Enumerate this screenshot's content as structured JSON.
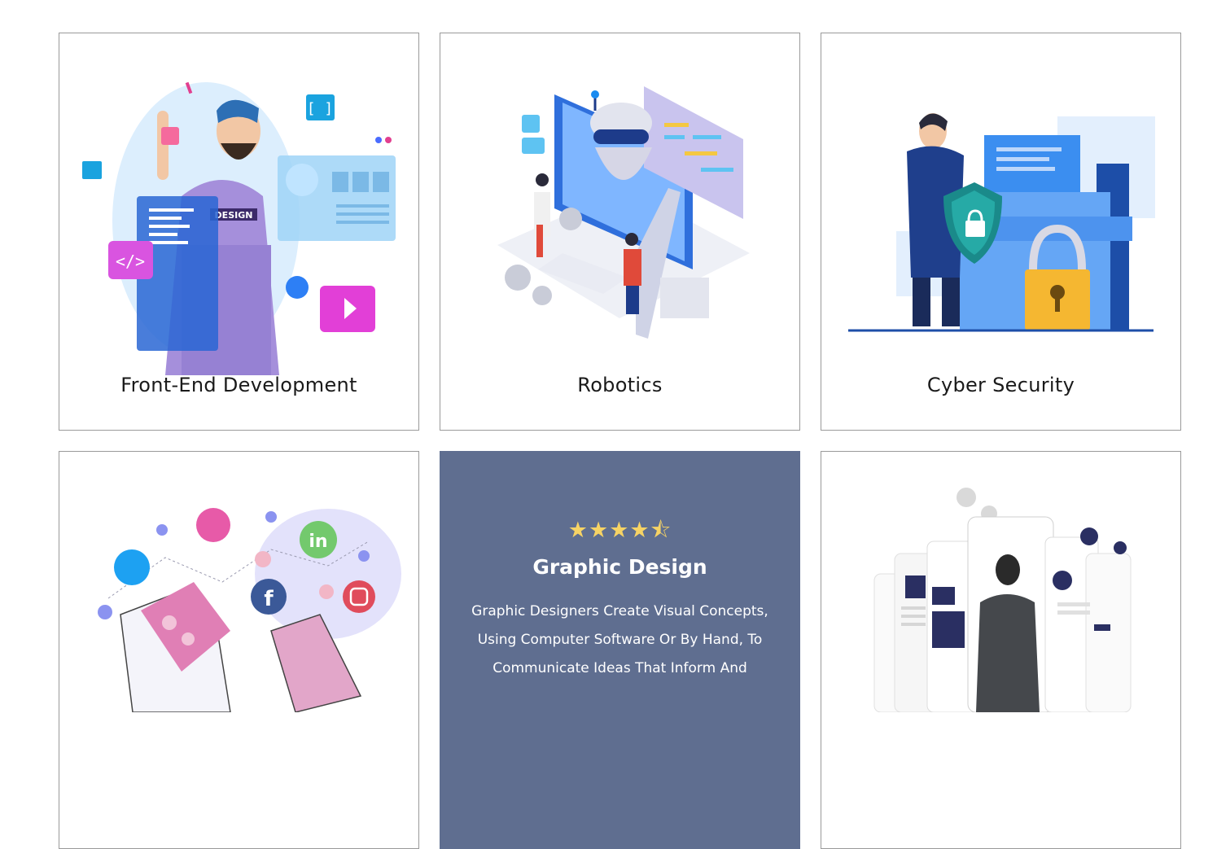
{
  "cards": [
    {
      "title": "Front-End Development",
      "badge": "DESIGN"
    },
    {
      "title": "Robotics"
    },
    {
      "title": "Cyber Security"
    },
    {
      "title": ""
    },
    {
      "title": "Graphic Design",
      "stars": "★★★★⯪",
      "rating": 4.5,
      "description": "Graphic Designers Create Visual Concepts, Using Computer Software Or By Hand, To Communicate Ideas That Inform And"
    },
    {
      "title": ""
    }
  ],
  "colors": {
    "featured_bg": "#5f6e90",
    "star": "#f6d365",
    "border": "#9a9a9a"
  }
}
